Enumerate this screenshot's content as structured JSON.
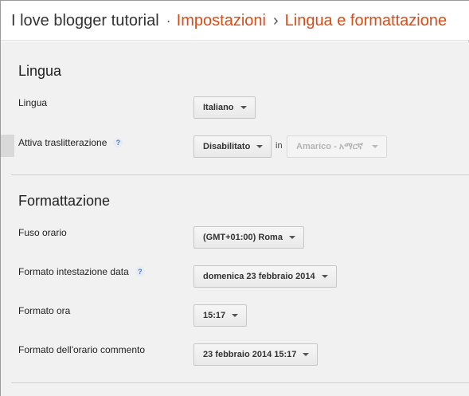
{
  "header": {
    "blog_name": "I love blogger tutorial",
    "separator": "·",
    "crumb1": "Impostazioni",
    "arrow": "›",
    "crumb2": "Lingua e formattazione"
  },
  "lingua_section": {
    "title": "Lingua",
    "lingua_label": "Lingua",
    "lingua_value": "Italiano",
    "translit_label": "Attiva traslitterazione",
    "help_glyph": "?",
    "translit_value": "Disabilitato",
    "in_text": "in",
    "translit_lang_value": "Amarico - አማርኛ"
  },
  "formattazione_section": {
    "title": "Formattazione",
    "timezone_label": "Fuso orario",
    "timezone_value": "(GMT+01:00) Roma",
    "date_header_label": "Formato intestazione data",
    "help_glyph": "?",
    "date_header_value": "domenica 23 febbraio 2014",
    "time_label": "Formato ora",
    "time_value": "15:17",
    "comment_label": "Formato dell'orario commento",
    "comment_value": "23 febbraio 2014 15:17"
  },
  "colors": {
    "accent": "#dd4b14",
    "panel_bg": "#f1f1f1"
  }
}
